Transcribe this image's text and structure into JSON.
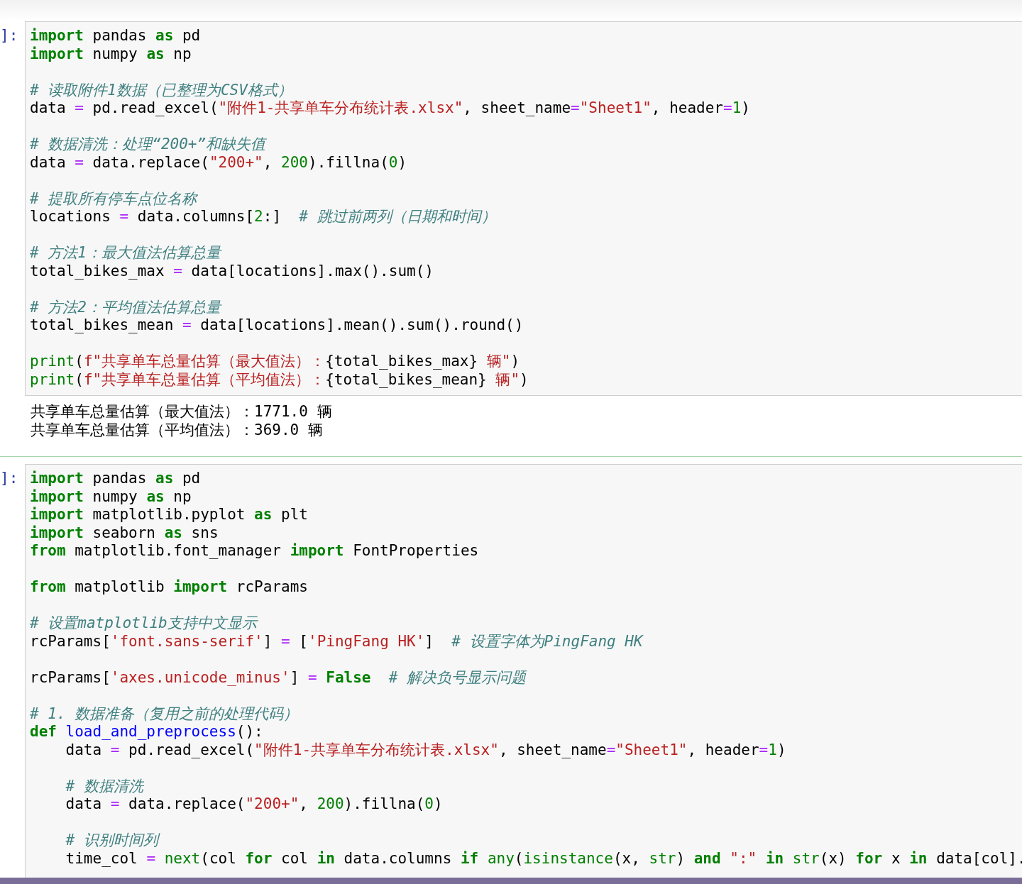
{
  "cells": [
    {
      "prompt": "]:",
      "selected": false,
      "lines": [
        {
          "tokens": [
            {
              "kind": "k",
              "text": "import"
            },
            {
              "kind": "n",
              "text": " pandas "
            },
            {
              "kind": "k",
              "text": "as"
            },
            {
              "kind": "n",
              "text": " pd"
            }
          ]
        },
        {
          "tokens": [
            {
              "kind": "k",
              "text": "import"
            },
            {
              "kind": "n",
              "text": " numpy "
            },
            {
              "kind": "k",
              "text": "as"
            },
            {
              "kind": "n",
              "text": " np"
            }
          ]
        },
        {
          "kind": "blank"
        },
        {
          "tokens": [
            {
              "kind": "c",
              "text": "# 读取附件1数据（已整理为CSV格式）"
            }
          ]
        },
        {
          "tokens": [
            {
              "kind": "n",
              "text": "data "
            },
            {
              "kind": "o",
              "text": "="
            },
            {
              "kind": "n",
              "text": " pd.read_excel("
            },
            {
              "kind": "s",
              "text": "\"附件1-共享单车分布统计表.xlsx\""
            },
            {
              "kind": "n",
              "text": ", sheet_name"
            },
            {
              "kind": "o",
              "text": "="
            },
            {
              "kind": "s",
              "text": "\"Sheet1\""
            },
            {
              "kind": "n",
              "text": ", header"
            },
            {
              "kind": "o",
              "text": "="
            },
            {
              "kind": "m",
              "text": "1"
            },
            {
              "kind": "n",
              "text": ")"
            }
          ]
        },
        {
          "kind": "blank"
        },
        {
          "tokens": [
            {
              "kind": "c",
              "text": "# 数据清洗：处理“200+”和缺失值"
            }
          ]
        },
        {
          "tokens": [
            {
              "kind": "n",
              "text": "data "
            },
            {
              "kind": "o",
              "text": "="
            },
            {
              "kind": "n",
              "text": " data.replace("
            },
            {
              "kind": "s",
              "text": "\"200+\""
            },
            {
              "kind": "n",
              "text": ", "
            },
            {
              "kind": "m",
              "text": "200"
            },
            {
              "kind": "n",
              "text": ").fillna("
            },
            {
              "kind": "m",
              "text": "0"
            },
            {
              "kind": "n",
              "text": ")"
            }
          ]
        },
        {
          "kind": "blank"
        },
        {
          "tokens": [
            {
              "kind": "c",
              "text": "# 提取所有停车点位名称"
            }
          ]
        },
        {
          "tokens": [
            {
              "kind": "n",
              "text": "locations "
            },
            {
              "kind": "o",
              "text": "="
            },
            {
              "kind": "n",
              "text": " data.columns["
            },
            {
              "kind": "m",
              "text": "2"
            },
            {
              "kind": "n",
              "text": ":]  "
            },
            {
              "kind": "c",
              "text": "# 跳过前两列（日期和时间）"
            }
          ]
        },
        {
          "kind": "blank"
        },
        {
          "tokens": [
            {
              "kind": "c",
              "text": "# 方法1：最大值法估算总量"
            }
          ]
        },
        {
          "tokens": [
            {
              "kind": "n",
              "text": "total_bikes_max "
            },
            {
              "kind": "o",
              "text": "="
            },
            {
              "kind": "n",
              "text": " data[locations].max().sum()"
            }
          ]
        },
        {
          "kind": "blank"
        },
        {
          "tokens": [
            {
              "kind": "c",
              "text": "# 方法2：平均值法估算总量"
            }
          ]
        },
        {
          "tokens": [
            {
              "kind": "n",
              "text": "total_bikes_mean "
            },
            {
              "kind": "o",
              "text": "="
            },
            {
              "kind": "n",
              "text": " data[locations].mean().sum().round()"
            }
          ]
        },
        {
          "kind": "blank"
        },
        {
          "tokens": [
            {
              "kind": "b",
              "text": "print"
            },
            {
              "kind": "n",
              "text": "("
            },
            {
              "kind": "s",
              "text": "f\"共享单车总量估算（最大值法）："
            },
            {
              "kind": "n",
              "text": "{total_bikes_max}"
            },
            {
              "kind": "s",
              "text": " 辆\""
            },
            {
              "kind": "n",
              "text": ")"
            }
          ]
        },
        {
          "tokens": [
            {
              "kind": "b",
              "text": "print"
            },
            {
              "kind": "n",
              "text": "("
            },
            {
              "kind": "s",
              "text": "f\"共享单车总量估算（平均值法）："
            },
            {
              "kind": "n",
              "text": "{total_bikes_mean}"
            },
            {
              "kind": "s",
              "text": " 辆\""
            },
            {
              "kind": "n",
              "text": ")"
            }
          ]
        }
      ],
      "outputs": [
        "共享单车总量估算（最大值法）：1771.0 辆",
        "共享单车总量估算（平均值法）：369.0 辆"
      ]
    },
    {
      "prompt": "]:",
      "selected": true,
      "lines": [
        {
          "tokens": [
            {
              "kind": "k",
              "text": "import"
            },
            {
              "kind": "n",
              "text": " pandas "
            },
            {
              "kind": "k",
              "text": "as"
            },
            {
              "kind": "n",
              "text": " pd"
            }
          ]
        },
        {
          "tokens": [
            {
              "kind": "k",
              "text": "import"
            },
            {
              "kind": "n",
              "text": " numpy "
            },
            {
              "kind": "k",
              "text": "as"
            },
            {
              "kind": "n",
              "text": " np"
            }
          ]
        },
        {
          "tokens": [
            {
              "kind": "k",
              "text": "import"
            },
            {
              "kind": "n",
              "text": " matplotlib.pyplot "
            },
            {
              "kind": "k",
              "text": "as"
            },
            {
              "kind": "n",
              "text": " plt"
            }
          ]
        },
        {
          "tokens": [
            {
              "kind": "k",
              "text": "import"
            },
            {
              "kind": "n",
              "text": " seaborn "
            },
            {
              "kind": "k",
              "text": "as"
            },
            {
              "kind": "n",
              "text": " sns"
            }
          ]
        },
        {
          "tokens": [
            {
              "kind": "k",
              "text": "from"
            },
            {
              "kind": "n",
              "text": " matplotlib.font_manager "
            },
            {
              "kind": "k",
              "text": "import"
            },
            {
              "kind": "n",
              "text": " FontProperties"
            }
          ]
        },
        {
          "kind": "blank"
        },
        {
          "tokens": [
            {
              "kind": "k",
              "text": "from"
            },
            {
              "kind": "n",
              "text": " matplotlib "
            },
            {
              "kind": "k",
              "text": "import"
            },
            {
              "kind": "n",
              "text": " rcParams"
            }
          ]
        },
        {
          "kind": "blank"
        },
        {
          "tokens": [
            {
              "kind": "c",
              "text": "# 设置matplotlib支持中文显示"
            }
          ]
        },
        {
          "tokens": [
            {
              "kind": "n",
              "text": "rcParams["
            },
            {
              "kind": "s",
              "text": "'font.sans-serif'"
            },
            {
              "kind": "n",
              "text": "] "
            },
            {
              "kind": "o",
              "text": "="
            },
            {
              "kind": "n",
              "text": " ["
            },
            {
              "kind": "s",
              "text": "'PingFang HK'"
            },
            {
              "kind": "n",
              "text": "]  "
            },
            {
              "kind": "c",
              "text": "# 设置字体为PingFang HK"
            }
          ]
        },
        {
          "kind": "blank"
        },
        {
          "tokens": [
            {
              "kind": "n",
              "text": "rcParams["
            },
            {
              "kind": "s",
              "text": "'axes.unicode_minus'"
            },
            {
              "kind": "n",
              "text": "] "
            },
            {
              "kind": "o",
              "text": "= "
            },
            {
              "kind": "k",
              "text": "False"
            },
            {
              "kind": "c",
              "text": "  # 解决负号显示问题"
            }
          ]
        },
        {
          "kind": "blank"
        },
        {
          "tokens": [
            {
              "kind": "c",
              "text": "# 1. 数据准备（复用之前的处理代码）"
            }
          ]
        },
        {
          "tokens": [
            {
              "kind": "k",
              "text": "def "
            },
            {
              "kind": "f",
              "text": "load_and_preprocess"
            },
            {
              "kind": "n",
              "text": "():"
            }
          ]
        },
        {
          "tokens": [
            {
              "kind": "n",
              "text": "    data "
            },
            {
              "kind": "o",
              "text": "="
            },
            {
              "kind": "n",
              "text": " pd.read_excel("
            },
            {
              "kind": "s",
              "text": "\"附件1-共享单车分布统计表.xlsx\""
            },
            {
              "kind": "n",
              "text": ", sheet_name"
            },
            {
              "kind": "o",
              "text": "="
            },
            {
              "kind": "s",
              "text": "\"Sheet1\""
            },
            {
              "kind": "n",
              "text": ", header"
            },
            {
              "kind": "o",
              "text": "="
            },
            {
              "kind": "m",
              "text": "1"
            },
            {
              "kind": "n",
              "text": ")"
            }
          ]
        },
        {
          "kind": "blank"
        },
        {
          "tokens": [
            {
              "kind": "c",
              "text": "    # 数据清洗"
            }
          ]
        },
        {
          "tokens": [
            {
              "kind": "n",
              "text": "    data "
            },
            {
              "kind": "o",
              "text": "="
            },
            {
              "kind": "n",
              "text": " data.replace("
            },
            {
              "kind": "s",
              "text": "\"200+\""
            },
            {
              "kind": "n",
              "text": ", "
            },
            {
              "kind": "m",
              "text": "200"
            },
            {
              "kind": "n",
              "text": ").fillna("
            },
            {
              "kind": "m",
              "text": "0"
            },
            {
              "kind": "n",
              "text": ")"
            }
          ]
        },
        {
          "kind": "blank"
        },
        {
          "tokens": [
            {
              "kind": "c",
              "text": "    # 识别时间列"
            }
          ]
        },
        {
          "tokens": [
            {
              "kind": "n",
              "text": "    time_col "
            },
            {
              "kind": "o",
              "text": "= "
            },
            {
              "kind": "b",
              "text": "next"
            },
            {
              "kind": "n",
              "text": "(col "
            },
            {
              "kind": "k",
              "text": "for"
            },
            {
              "kind": "n",
              "text": " col "
            },
            {
              "kind": "k",
              "text": "in"
            },
            {
              "kind": "n",
              "text": " data.columns "
            },
            {
              "kind": "k",
              "text": "if "
            },
            {
              "kind": "b",
              "text": "any"
            },
            {
              "kind": "n",
              "text": "("
            },
            {
              "kind": "b",
              "text": "isinstance"
            },
            {
              "kind": "n",
              "text": "(x, "
            },
            {
              "kind": "b",
              "text": "str"
            },
            {
              "kind": "n",
              "text": ") "
            },
            {
              "kind": "k",
              "text": "and "
            },
            {
              "kind": "s",
              "text": "\":\" "
            },
            {
              "kind": "k",
              "text": "in "
            },
            {
              "kind": "b",
              "text": "str"
            },
            {
              "kind": "n",
              "text": "(x) "
            },
            {
              "kind": "k",
              "text": "for"
            },
            {
              "kind": "n",
              "text": " x "
            },
            {
              "kind": "k",
              "text": "in"
            },
            {
              "kind": "n",
              "text": " data[col]."
            }
          ]
        }
      ]
    }
  ]
}
